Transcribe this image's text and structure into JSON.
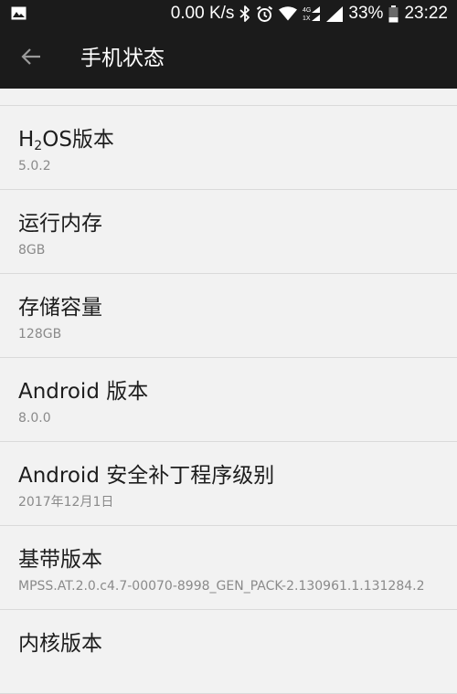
{
  "status_bar": {
    "net_speed": "0.00 K/s",
    "network_badge_top": "4G",
    "network_badge_bottom": "1X",
    "battery_percent": "33%",
    "time": "23:22"
  },
  "app_bar": {
    "title": "手机状态"
  },
  "items": [
    {
      "title_prefix": "H",
      "title_sub": "2",
      "title_suffix": "OS版本",
      "value": "5.0.2"
    },
    {
      "title": "运行内存",
      "value": "8GB"
    },
    {
      "title": "存储容量",
      "value": "128GB"
    },
    {
      "title": "Android 版本",
      "value": "8.0.0"
    },
    {
      "title": "Android 安全补丁程序级别",
      "value": "2017年12月1日"
    },
    {
      "title": "基带版本",
      "value": "MPSS.AT.2.0.c4.7-00070-8998_GEN_PACK-2.130961.1.131284.2"
    },
    {
      "title": "内核版本",
      "value": ""
    }
  ]
}
